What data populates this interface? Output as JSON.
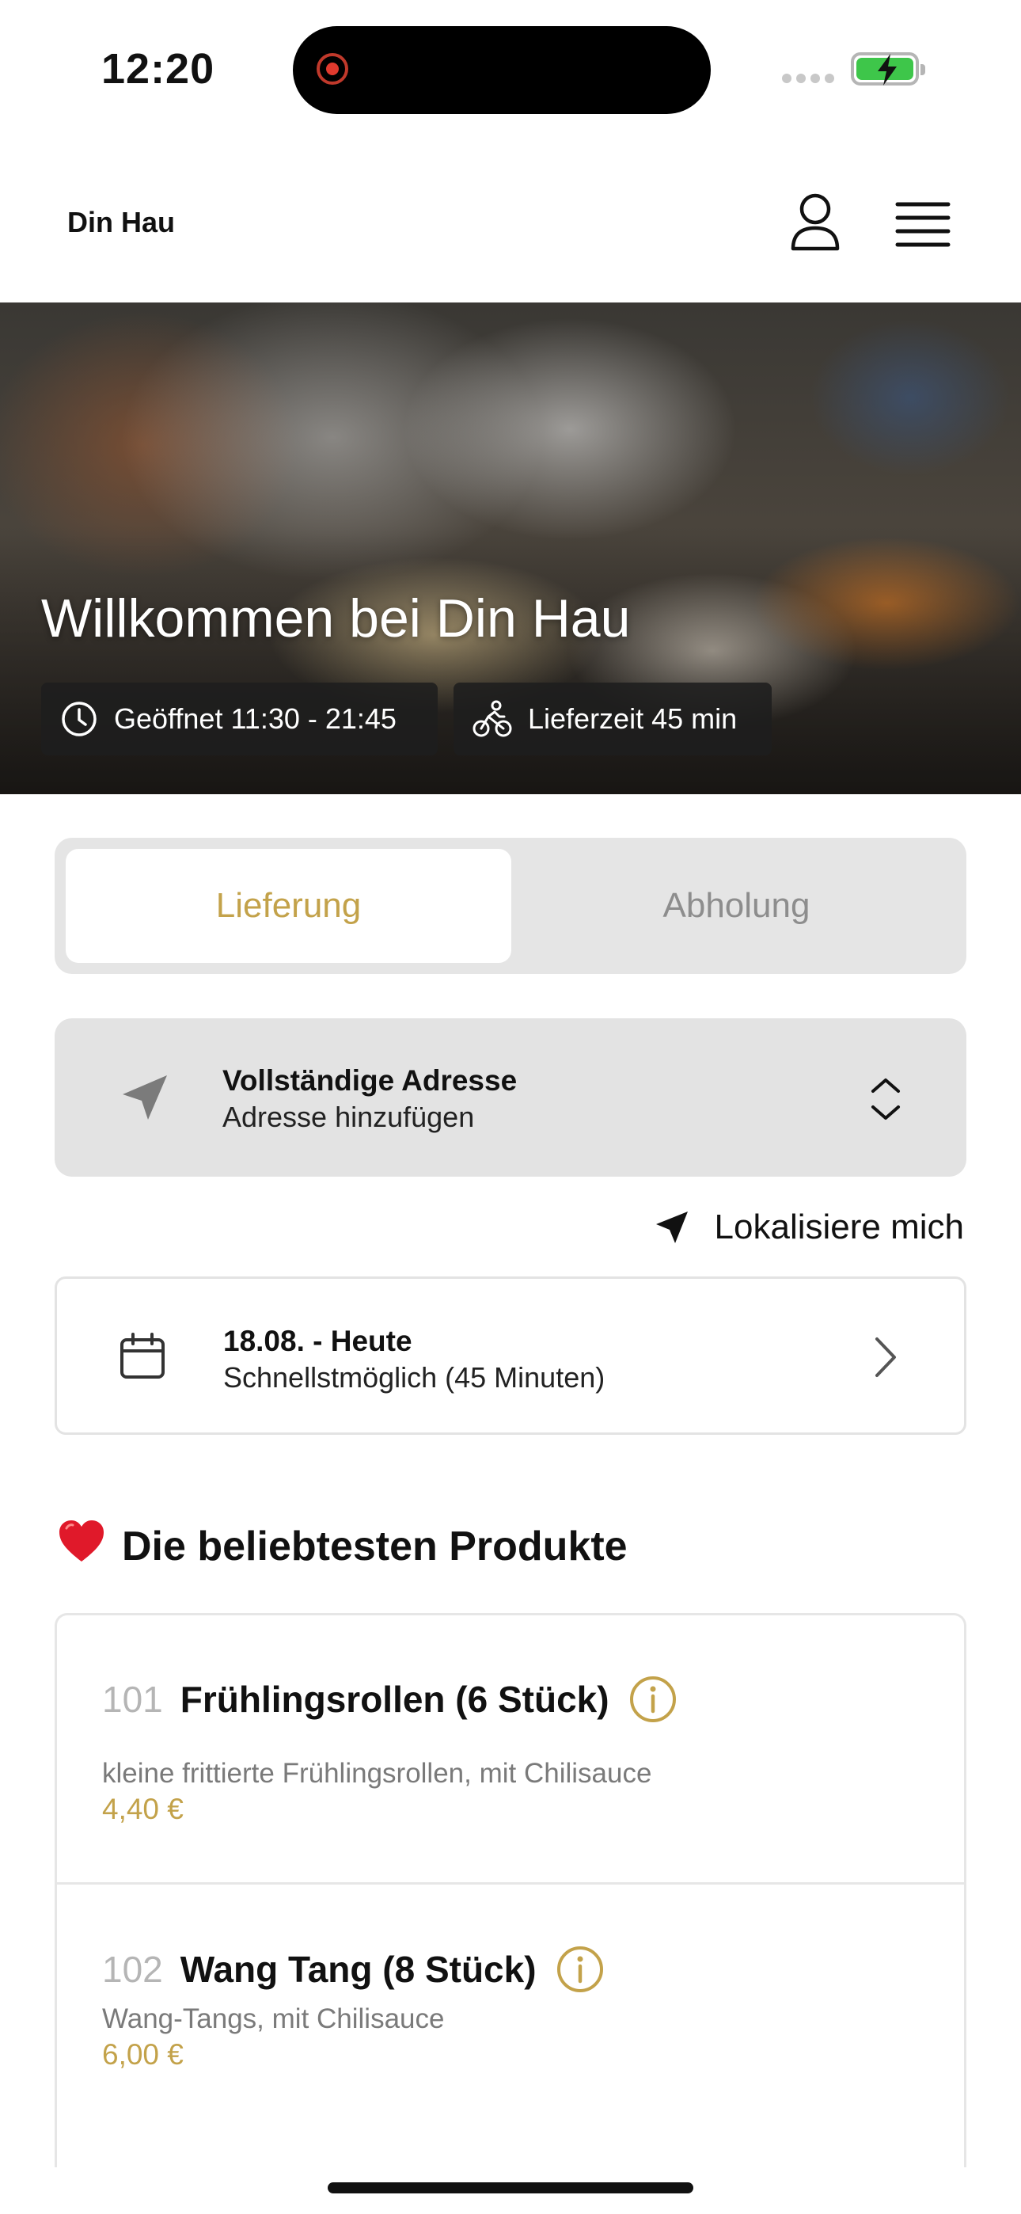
{
  "status_bar": {
    "time": "12:20"
  },
  "header": {
    "brand": "Din Hau"
  },
  "hero": {
    "title": "Willkommen bei Din Hau",
    "opening_hours": "Geöffnet 11:30 - 21:45",
    "delivery_time": "Lieferzeit 45 min"
  },
  "mode_toggle": {
    "options": [
      "Lieferung",
      "Abholung"
    ],
    "selected": "Lieferung",
    "accent_color": "#c3a24a"
  },
  "address": {
    "title": "Vollständige Adresse",
    "subtitle": "Adresse hinzufügen"
  },
  "locate": {
    "label": "Lokalisiere mich"
  },
  "schedule": {
    "title": "18.08. - Heute",
    "subtitle": "Schnellstmöglich (45 Minuten)"
  },
  "popular": {
    "title": "Die beliebtesten Produkte",
    "emoji": "❤️",
    "products": [
      {
        "number": "101",
        "name": "Frühlingsrollen (6 Stück)",
        "description": "kleine frittierte Frühlingsrollen, mit Chilisauce",
        "price": "4,40 €"
      },
      {
        "number": "102",
        "name": "Wang Tang (8 Stück)",
        "description": "Wang-Tangs, mit Chilisauce",
        "price": "6,00 €"
      }
    ]
  }
}
